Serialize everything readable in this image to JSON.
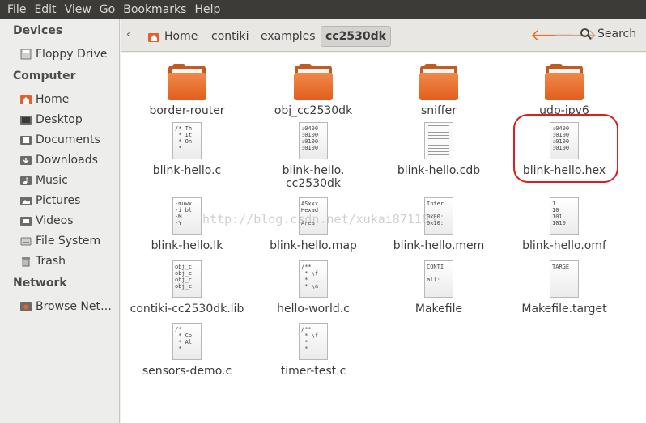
{
  "menubar": [
    "File",
    "Edit",
    "View",
    "Go",
    "Bookmarks",
    "Help"
  ],
  "sidebar": {
    "devices_heading": "Devices",
    "floppy": "Floppy Drive",
    "computer_heading": "Computer",
    "home": "Home",
    "desktop": "Desktop",
    "documents": "Documents",
    "downloads": "Downloads",
    "music": "Music",
    "pictures": "Pictures",
    "videos": "Videos",
    "file_system": "File System",
    "trash": "Trash",
    "network_heading": "Network",
    "browse_network": "Browse Net…"
  },
  "toolbar": {
    "breadcrumb": [
      "Home",
      "contiki",
      "examples",
      "cc2530dk"
    ],
    "search_label": "Search"
  },
  "files": [
    {
      "name": "border-router",
      "type": "folder"
    },
    {
      "name": "obj_cc2530dk",
      "type": "folder"
    },
    {
      "name": "sniffer",
      "type": "folder"
    },
    {
      "name": "udp-ipv6",
      "type": "folder"
    },
    {
      "name": "blink-hello.c",
      "type": "text",
      "preview": [
        "/* Th",
        " * It",
        " * On",
        " *"
      ]
    },
    {
      "name": "blink-hello.",
      "name2": "cc2530dk",
      "type": "text",
      "preview": [
        ":0400",
        ":0100",
        ":0100",
        ":0100"
      ]
    },
    {
      "name": "blink-hello.cdb",
      "type": "lines"
    },
    {
      "name": "blink-hello.hex",
      "type": "text",
      "preview": [
        ":0400",
        ":0100",
        ":0100",
        ":0100"
      ]
    },
    {
      "name": "blink-hello.lk",
      "type": "text",
      "preview": [
        "-muwx",
        "-i bl",
        "-M",
        "-Y"
      ]
    },
    {
      "name": "blink-hello.map",
      "type": "text",
      "preview": [
        "ASxxx",
        "Hexad",
        "",
        "Area"
      ]
    },
    {
      "name": "blink-hello.mem",
      "type": "text",
      "preview": [
        "Inter",
        "",
        "0x00:",
        "0x10:"
      ]
    },
    {
      "name": "blink-hello.omf",
      "type": "text",
      "preview": [
        "1",
        "10",
        "101",
        "1010"
      ]
    },
    {
      "name": "contiki-cc2530dk.lib",
      "type": "text",
      "preview": [
        "obj_c",
        "obj_c",
        "obj_c",
        "obj_c"
      ]
    },
    {
      "name": "hello-world.c",
      "type": "text",
      "preview": [
        "/**",
        " * \\f",
        " *",
        " * \\a"
      ]
    },
    {
      "name": "Makefile",
      "type": "text",
      "preview": [
        "CONTI",
        "",
        "all:",
        ""
      ]
    },
    {
      "name": "Makefile.target",
      "type": "text",
      "preview": [
        "TARGE",
        "",
        "",
        ""
      ]
    },
    {
      "name": "sensors-demo.c",
      "type": "text",
      "preview": [
        "/*",
        " * Co",
        " * Al",
        " *"
      ]
    },
    {
      "name": "timer-test.c",
      "type": "text",
      "preview": [
        "/**",
        " * \\f",
        " *",
        " *"
      ]
    }
  ],
  "watermark": "http://blog.csdn.net/xukai871105",
  "colors": {
    "menubar_bg": "#3c3b37",
    "folder_orange": "#e25d1d",
    "highlight_red": "#d92020",
    "nav_arrow": "#e0752f"
  }
}
